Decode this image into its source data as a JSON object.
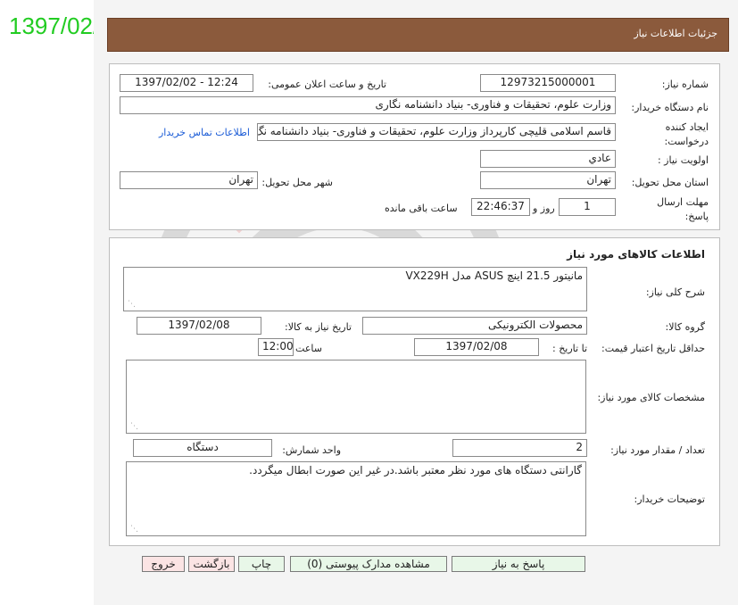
{
  "stamp_date": "1397/02/02",
  "header": {
    "title": "جزئیات اطلاعات نیاز"
  },
  "info": {
    "need_number_label": "شماره نیاز:",
    "need_number": "12973215000001",
    "announce_label": "تاریخ و ساعت اعلان عمومی:",
    "announce_value": "1397/02/02 - 12:24",
    "buyer_org_label": "نام دستگاه خریدار:",
    "buyer_org": "وزارت علوم، تحقیقات و فناوری- بنیاد دانشنامه نگاری",
    "requester_label_1": "ایجاد کننده",
    "requester_label_2": "درخواست:",
    "requester": "قاسم اسلامی قلیچی کارپرداز وزارت علوم، تحقیقات و فناوری- بنیاد دانشنامه نگ",
    "contact_link": "اطلاعات تماس خریدار",
    "priority_label": "اولویت نیاز :",
    "priority": "عادي",
    "province_label": "استان محل تحویل:",
    "province": "تهران",
    "city_label": "شهر محل تحویل:",
    "city": "تهران",
    "deadline_label_1": "مهلت ارسال",
    "deadline_label_2": "پاسخ:",
    "deadline_days": "1",
    "deadline_days_text": "روز و",
    "deadline_time": "22:46:37",
    "deadline_remaining_text": "ساعت باقی مانده"
  },
  "goods": {
    "section_title": "اطلاعات کالاهای مورد نیاز",
    "description_label": "شرح کلی نیاز:",
    "description": "مانیتور 21.5 اینچ ASUS مدل VX229H",
    "group_label": "گروه کالا:",
    "group": "محصولات الکترونیکی",
    "need_date_label": "تاریخ نیاز به کالا:",
    "need_date": "1397/02/08",
    "validity_label": "حداقل تاریخ اعتبار قیمت:",
    "validity_to_label": "تا تاریخ :",
    "validity_date": "1397/02/08",
    "time_label": "ساعت :",
    "time_value": "12:00",
    "specs_label": "مشخصات کالای مورد نیاز:",
    "specs": "",
    "qty_label": "تعداد / مقدار مورد نیاز:",
    "qty": "2",
    "unit_label": "واحد شمارش:",
    "unit": "دستگاه",
    "notes_label": "توضیحات خریدار:",
    "notes": "گارانتی دستگاه های مورد نظر معتبر باشد.در غیر این صورت ابطال میگردد."
  },
  "buttons": {
    "reply": "پاسخ به نیاز",
    "attachments": "مشاهده مدارک پیوستی (0)",
    "print": "چاپ",
    "back": "بازگشت",
    "exit": "خروج"
  }
}
